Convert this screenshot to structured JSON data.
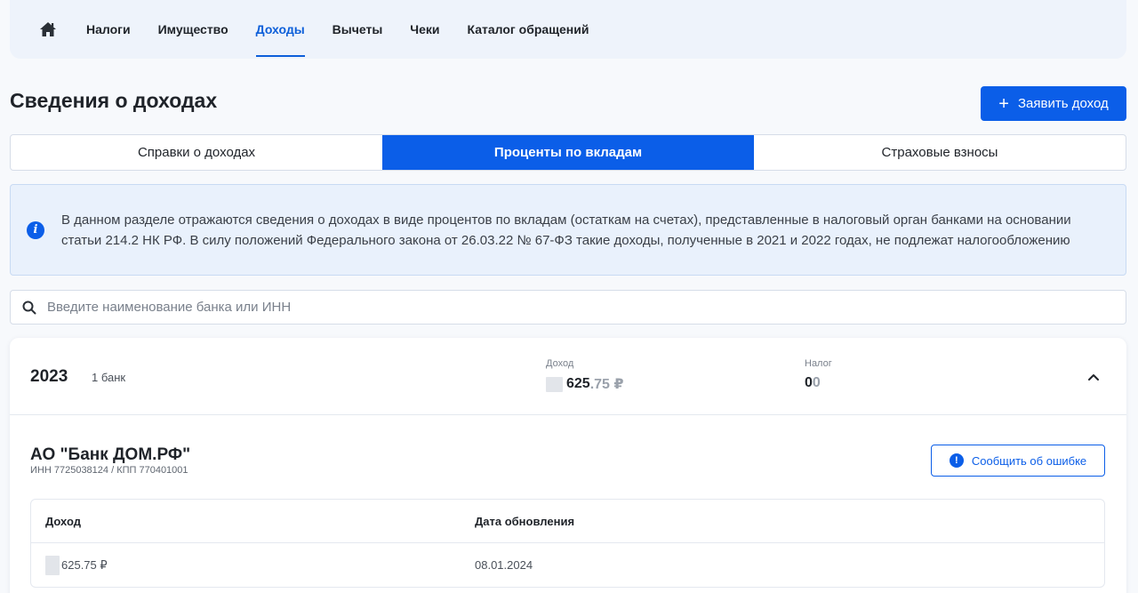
{
  "nav": {
    "items": [
      {
        "label": "Налоги",
        "active": false
      },
      {
        "label": "Имущество",
        "active": false
      },
      {
        "label": "Доходы",
        "active": true
      },
      {
        "label": "Вычеты",
        "active": false
      },
      {
        "label": "Чеки",
        "active": false
      },
      {
        "label": "Каталог обращений",
        "active": false
      }
    ]
  },
  "page": {
    "title": "Сведения о доходах",
    "declare_button": "Заявить доход"
  },
  "tabs": [
    {
      "label": "Справки о доходах",
      "active": false
    },
    {
      "label": "Проценты по вкладам",
      "active": true
    },
    {
      "label": "Страховые взносы",
      "active": false
    }
  ],
  "info": {
    "text": "В данном разделе отражаются сведения о доходах в виде процентов по вкладам (остаткам на счетах), представленные в налоговый орган банками на основании статьи 214.2 НК РФ. В силу положений Федерального закона от 26.03.22 № 67-ФЗ такие доходы, полученные в 2021 и 2022 годах, не подлежат налогообложению"
  },
  "search": {
    "placeholder": "Введите наименование банка или ИНН",
    "value": ""
  },
  "year_card": {
    "year": "2023",
    "bank_count": "1 банк",
    "income_label": "Доход",
    "income_main": "625",
    "income_fraction": ".75 ₽",
    "tax_label": "Налог",
    "tax_main": "0",
    "tax_fraction": "0",
    "bank": {
      "name": "АО \"Банк ДОМ.РФ\"",
      "ids": "ИНН 7725038124 / КПП 770401001",
      "report_button": "Сообщить об ошибке"
    },
    "table": {
      "headers": [
        "Доход",
        "Дата обновления"
      ],
      "rows": [
        {
          "income": "625.75 ₽",
          "date": "08.01.2024"
        }
      ]
    }
  },
  "colors": {
    "accent": "#0b5ee8",
    "nav_active": "#0d5fd9",
    "info_bg": "#e9f1fc"
  }
}
